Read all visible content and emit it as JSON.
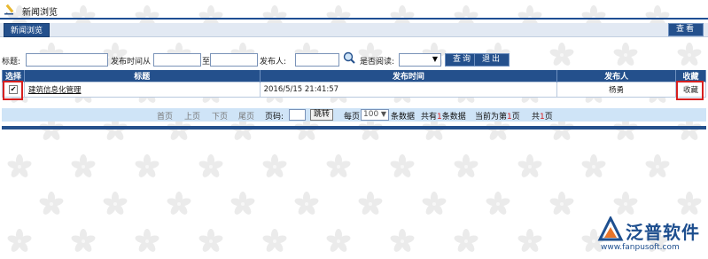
{
  "header": {
    "title": "新闻浏览"
  },
  "tabs": {
    "active_label": "新闻浏览",
    "view_label": "查看"
  },
  "search": {
    "title_label": "标题:",
    "title_value": "",
    "publish_time_from_label": "发布时间从",
    "from_value": "",
    "to_label": "至",
    "to_value": "",
    "publisher_label": "发布人:",
    "publisher_value": "",
    "read_label": "是否阅读:",
    "read_value": "",
    "query_button": "查询",
    "exit_button": "退出"
  },
  "grid": {
    "columns": [
      "选择",
      "标题",
      "发布时间",
      "发布人",
      "收藏"
    ],
    "rows": [
      {
        "checked": true,
        "title": "建筑信息化管理",
        "publish_time": "2016/5/15 21:41:57",
        "publisher": "杨勇",
        "favorite": "收藏"
      }
    ]
  },
  "pager": {
    "first": "首页",
    "prev": "上页",
    "next": "下页",
    "last": "尾页",
    "page_no_label": "页码:",
    "page_no_value": "",
    "jump_button": "跳转",
    "per_page_label": "每页",
    "per_page_value": "100",
    "per_page_suffix": "条数据",
    "total_prefix": "共有",
    "total_count": "1",
    "total_suffix": "条数据",
    "current_prefix": "当前为第",
    "current_page": "1",
    "current_suffix": "页",
    "pages_prefix": "共",
    "pages_count": "1",
    "pages_suffix": "页"
  },
  "logo": {
    "brand": "泛普软件",
    "url": "www.fanpusoft.com"
  },
  "colors": {
    "primary_blue": "#24508c",
    "header_line": "#1f4f94",
    "pager_bg": "#cfe4f7",
    "highlight_red": "#d62020"
  }
}
